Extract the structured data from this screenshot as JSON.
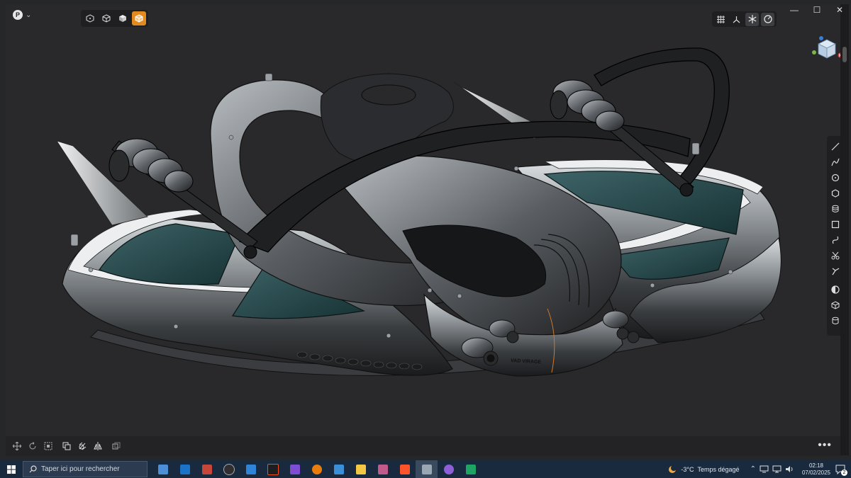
{
  "window": {
    "profile_letter": "P",
    "controls": [
      "minimize",
      "maximize",
      "close"
    ]
  },
  "view_toolbar": {
    "buttons": [
      "wireframe-view",
      "hidden-line-view",
      "shaded-view",
      "shaded-edges-view"
    ],
    "active": "shaded-edges-view",
    "accent": "#e38a1e"
  },
  "right_top_tools": [
    "grid-toggle",
    "axis-toggle",
    "snap-toggle",
    "environment-toggle"
  ],
  "model": {
    "hull_label": "VAD VIRAGE"
  },
  "side_tools": [
    "line-tool",
    "spline-tool",
    "circle-tool",
    "polygon-tool",
    "extrude-tool",
    "rectangle-tool",
    "curve-tool",
    "trim-tool",
    "project-tool",
    "revolve-tool",
    "solid-tool",
    "cylinder-tool"
  ],
  "bottom_tools": [
    "move-tool",
    "rotate-tool",
    "scale-tool",
    "copy-tool",
    "boolean-tool",
    "mirror-tool",
    "pattern-tool"
  ],
  "taskbar": {
    "search_placeholder": "Taper ici pour rechercher",
    "apps": [
      "explorer",
      "outlook",
      "app-red",
      "obs",
      "affinity-designer",
      "figma",
      "affinity-photo",
      "blender",
      "calculator",
      "file-explorer",
      "game-app",
      "brave",
      "shapr3d",
      "discord",
      "sheets"
    ],
    "weather_temp": "-3°C",
    "weather_desc": "Temps dégagé",
    "time": "02:18",
    "date": "07/02/2025",
    "notifications": "2"
  }
}
